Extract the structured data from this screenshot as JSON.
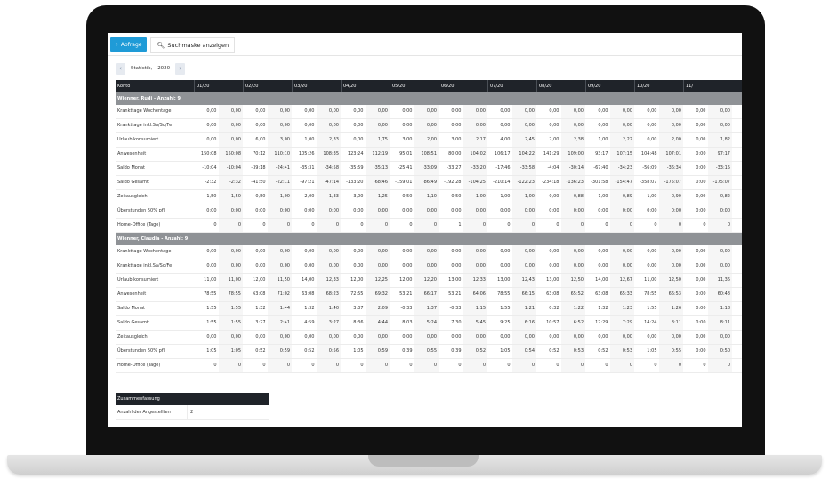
{
  "toolbar": {
    "query_label": "Abfrage",
    "query_icon": "caret-right-icon",
    "search_label": "Suchmaske anzeigen",
    "search_icon": "search-icon"
  },
  "pager": {
    "prev": "‹",
    "label": "Statistik,",
    "year": "2020",
    "next": "›"
  },
  "columns": [
    "Konto",
    "01/20",
    "02/20",
    "03/20",
    "04/20",
    "05/20",
    "06/20",
    "07/20",
    "08/20",
    "09/20",
    "10/20",
    "11/"
  ],
  "groups": [
    {
      "title": "Wienner, Rudi - Anzahl: 9",
      "rows": [
        {
          "label": "Krankttage Wochentage",
          "values": [
            "0,00",
            "0,00",
            "0,00",
            "0,00",
            "0,00",
            "0,00",
            "0,00",
            "0,00",
            "0,00",
            "0,00",
            "0,00",
            "0,00",
            "0,00",
            "0,00",
            "0,00",
            "0,00",
            "0,00",
            "0,00",
            "0,00",
            "0,00",
            "0,00",
            "0,00"
          ]
        },
        {
          "label": "Krankttage inkl.Sa/So/Fe",
          "values": [
            "0,00",
            "0,00",
            "0,00",
            "0,00",
            "0,00",
            "0,00",
            "0,00",
            "0,00",
            "0,00",
            "0,00",
            "0,00",
            "0,00",
            "0,00",
            "0,00",
            "0,00",
            "0,00",
            "0,00",
            "0,00",
            "0,00",
            "0,00",
            "0,00",
            "0,00"
          ]
        },
        {
          "label": "Urlaub konsumiert",
          "values": [
            "0,00",
            "0,00",
            "6,00",
            "3,00",
            "1,00",
            "2,33",
            "0,00",
            "1,75",
            "3,00",
            "2,00",
            "3,00",
            "2,17",
            "4,00",
            "2,45",
            "2,00",
            "2,38",
            "1,00",
            "2,22",
            "0,00",
            "2,00",
            "0,00",
            "1,82"
          ]
        },
        {
          "label": "Anwesenheit",
          "values": [
            "150:08",
            "150:08",
            "70:12",
            "110:10",
            "105:26",
            "108:35",
            "123:24",
            "112:19",
            "95:01",
            "108:51",
            "80:00",
            "104:02",
            "106:17",
            "104:22",
            "141:29",
            "109:00",
            "93:17",
            "107:15",
            "104:48",
            "107:01",
            "0:00",
            "97:17"
          ]
        },
        {
          "label": "Saldo Monat",
          "values": [
            "-10:04",
            "-10:04",
            "-39:18",
            "-24:41",
            "-35:31",
            "-34:58",
            "-35:59",
            "-35:13",
            "-25:41",
            "-33:09",
            "-33:27",
            "-33:20",
            "-17:46",
            "-33:58",
            "-4:04",
            "-30:14",
            "-67:40",
            "-34:23",
            "-56:09",
            "-36:34",
            "0:00",
            "-33:15"
          ]
        },
        {
          "label": "Saldo Gesamt",
          "values": [
            "-2:32",
            "-2:32",
            "-41:50",
            "-22:11",
            "-97:21",
            "-47:14",
            "-133:20",
            "-68:46",
            "-159:01",
            "-86:49",
            "-192:28",
            "-104:25",
            "-210:14",
            "-122:23",
            "-234:18",
            "-136:23",
            "-301:58",
            "-154:47",
            "-358:07",
            "-175:07",
            "0:00",
            "-175:07"
          ]
        },
        {
          "label": "Zeitausgleich",
          "values": [
            "1,50",
            "1,50",
            "0,50",
            "1,00",
            "2,00",
            "1,33",
            "3,00",
            "1,25",
            "0,50",
            "1,10",
            "0,50",
            "1,00",
            "1,00",
            "1,00",
            "0,00",
            "0,88",
            "1,00",
            "0,89",
            "1,00",
            "0,90",
            "0,00",
            "0,82"
          ]
        },
        {
          "label": "Überstunden 50% pfl.",
          "values": [
            "0:00",
            "0:00",
            "0:00",
            "0:00",
            "0:00",
            "0:00",
            "0:00",
            "0:00",
            "0:00",
            "0:00",
            "0:00",
            "0:00",
            "0:00",
            "0:00",
            "0:00",
            "0:00",
            "0:00",
            "0:00",
            "0:00",
            "0:00",
            "0:00",
            "0:00"
          ]
        },
        {
          "label": "Home-Office (Tage)",
          "values": [
            "0",
            "0",
            "0",
            "0",
            "0",
            "0",
            "0",
            "0",
            "0",
            "0",
            "1",
            "0",
            "0",
            "0",
            "0",
            "0",
            "0",
            "0",
            "0",
            "0",
            "0",
            "0"
          ]
        }
      ]
    },
    {
      "title": "Wienner, Claudia - Anzahl: 9",
      "rows": [
        {
          "label": "Krankttage Wochentage",
          "values": [
            "0,00",
            "0,00",
            "0,00",
            "0,00",
            "0,00",
            "0,00",
            "0,00",
            "0,00",
            "0,00",
            "0,00",
            "0,00",
            "0,00",
            "0,00",
            "0,00",
            "0,00",
            "0,00",
            "0,00",
            "0,00",
            "0,00",
            "0,00",
            "0,00",
            "0,00"
          ]
        },
        {
          "label": "Krankttage inkl.Sa/So/Fe",
          "values": [
            "0,00",
            "0,00",
            "0,00",
            "0,00",
            "0,00",
            "0,00",
            "0,00",
            "0,00",
            "0,00",
            "0,00",
            "0,00",
            "0,00",
            "0,00",
            "0,00",
            "0,00",
            "0,00",
            "0,00",
            "0,00",
            "0,00",
            "0,00",
            "0,00",
            "0,00"
          ]
        },
        {
          "label": "Urlaub konsumiert",
          "values": [
            "11,00",
            "11,00",
            "12,00",
            "11,50",
            "14,00",
            "12,33",
            "12,00",
            "12,25",
            "12,00",
            "12,20",
            "13,00",
            "12,33",
            "13,00",
            "12,43",
            "13,00",
            "12,50",
            "14,00",
            "12,67",
            "11,00",
            "12,50",
            "0,00",
            "11,36"
          ]
        },
        {
          "label": "Anwesenheit",
          "values": [
            "78:55",
            "78:55",
            "63:08",
            "71:02",
            "63:08",
            "68:23",
            "72:55",
            "69:32",
            "53:21",
            "66:17",
            "53:21",
            "64:06",
            "78:55",
            "66:15",
            "63:08",
            "65:52",
            "63:08",
            "65:33",
            "78:55",
            "66:53",
            "0:00",
            "60:48"
          ]
        },
        {
          "label": "Saldo Monat",
          "values": [
            "1:55",
            "1:55",
            "1:32",
            "1:44",
            "1:32",
            "1:40",
            "3:37",
            "2:09",
            "-0:33",
            "1:37",
            "-0:33",
            "1:15",
            "1:55",
            "1:21",
            "0:32",
            "1:22",
            "1:32",
            "1:23",
            "1:55",
            "1:26",
            "0:00",
            "1:18"
          ]
        },
        {
          "label": "Saldo Gesamt",
          "values": [
            "1:55",
            "1:55",
            "3:27",
            "2:41",
            "4:59",
            "3:27",
            "8:36",
            "4:44",
            "8:03",
            "5:24",
            "7:30",
            "5:45",
            "9:25",
            "6:16",
            "10:57",
            "6:52",
            "12:29",
            "7:29",
            "14:24",
            "8:11",
            "0:00",
            "8:11"
          ]
        },
        {
          "label": "Zeitausgleich",
          "values": [
            "0,00",
            "0,00",
            "0,00",
            "0,00",
            "0,00",
            "0,00",
            "0,00",
            "0,00",
            "0,00",
            "0,00",
            "0,00",
            "0,00",
            "0,00",
            "0,00",
            "0,00",
            "0,00",
            "0,00",
            "0,00",
            "0,00",
            "0,00",
            "0,00",
            "0,00"
          ]
        },
        {
          "label": "Überstunden 50% pfl.",
          "values": [
            "1:05",
            "1:05",
            "0:52",
            "0:59",
            "0:52",
            "0:56",
            "1:05",
            "0:59",
            "0:39",
            "0:55",
            "0:39",
            "0:52",
            "1:05",
            "0:54",
            "0:52",
            "0:53",
            "0:52",
            "0:53",
            "1:05",
            "0:55",
            "0:00",
            "0:50"
          ]
        },
        {
          "label": "Home-Office (Tage)",
          "values": [
            "0",
            "0",
            "0",
            "0",
            "0",
            "0",
            "0",
            "0",
            "0",
            "0",
            "0",
            "0",
            "0",
            "0",
            "0",
            "0",
            "0",
            "0",
            "0",
            "0",
            "0",
            "0"
          ]
        }
      ]
    }
  ],
  "summary": {
    "title": "Zusammenfassung",
    "row_label": "Anzahl der Angestellten",
    "row_value": "2"
  }
}
